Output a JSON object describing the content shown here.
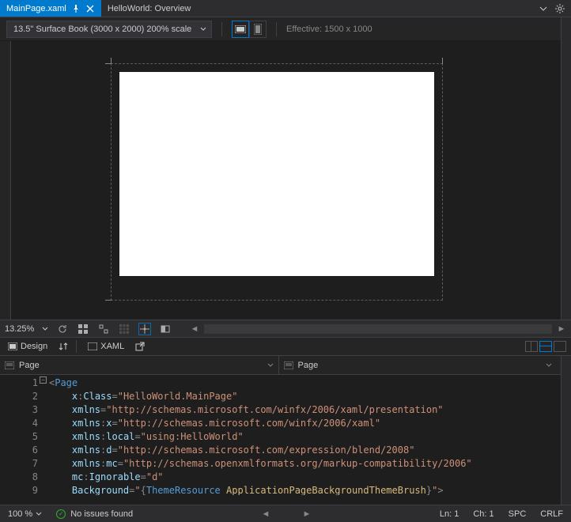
{
  "tabs": {
    "active": {
      "label": "MainPage.xaml"
    },
    "inactive": {
      "label": "HelloWorld: Overview"
    }
  },
  "toolbar": {
    "device": "13.5\" Surface Book (3000 x 2000) 200% scale",
    "effective": "Effective: 1500 x 1000"
  },
  "designStatus": {
    "zoom": "13.25%"
  },
  "split": {
    "design": "Design",
    "xaml": "XAML"
  },
  "nav": {
    "left": "Page",
    "right": "Page"
  },
  "code": {
    "lines": [
      {
        "n": "1",
        "html": "<span class='tok-punc'>&lt;</span><span class='tok-tag'>Page</span>"
      },
      {
        "n": "2",
        "html": "    <span class='tok-attr'>x</span><span class='tok-punc'>:</span><span class='tok-attr'>Class</span><span class='tok-punc'>=</span><span class='tok-str'>\"HelloWorld.MainPage\"</span>"
      },
      {
        "n": "3",
        "html": "    <span class='tok-attr'>xmlns</span><span class='tok-punc'>=</span><span class='tok-str'>\"http://schemas.microsoft.com/winfx/2006/xaml/presentation\"</span>"
      },
      {
        "n": "4",
        "html": "    <span class='tok-attr'>xmlns</span><span class='tok-punc'>:</span><span class='tok-attr'>x</span><span class='tok-punc'>=</span><span class='tok-str'>\"http://schemas.microsoft.com/winfx/2006/xaml\"</span>"
      },
      {
        "n": "5",
        "html": "    <span class='tok-attr'>xmlns</span><span class='tok-punc'>:</span><span class='tok-attr'>local</span><span class='tok-punc'>=</span><span class='tok-str'>\"using:HelloWorld\"</span>"
      },
      {
        "n": "6",
        "html": "    <span class='tok-attr'>xmlns</span><span class='tok-punc'>:</span><span class='tok-attr'>d</span><span class='tok-punc'>=</span><span class='tok-str'>\"http://schemas.microsoft.com/expression/blend/2008\"</span>"
      },
      {
        "n": "7",
        "html": "    <span class='tok-attr'>xmlns</span><span class='tok-punc'>:</span><span class='tok-attr'>mc</span><span class='tok-punc'>=</span><span class='tok-str'>\"http://schemas.openxmlformats.org/markup-compatibility/2006\"</span>"
      },
      {
        "n": "8",
        "html": "    <span class='tok-attr'>mc</span><span class='tok-punc'>:</span><span class='tok-attr'>Ignorable</span><span class='tok-punc'>=</span><span class='tok-str'>\"d\"</span>"
      },
      {
        "n": "9",
        "html": "    <span class='tok-attr'>Background</span><span class='tok-punc'>=</span><span class='tok-str'>\"</span><span class='tok-punc'>{</span><span class='tok-tag'>ThemeResource</span> <span class='tok-res'>ApplicationPageBackgroundThemeBrush</span><span class='tok-punc'>}</span><span class='tok-str'>\"</span><span class='tok-punc'>&gt;</span>"
      }
    ]
  },
  "status": {
    "zoom": "100 %",
    "issues": "No issues found",
    "ln": "Ln: 1",
    "ch": "Ch: 1",
    "spc": "SPC",
    "crlf": "CRLF"
  }
}
